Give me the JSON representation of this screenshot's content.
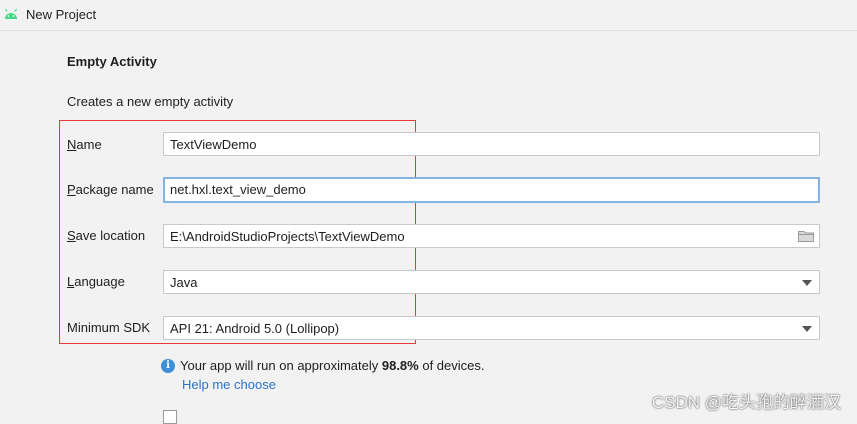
{
  "window": {
    "title": "New Project",
    "icon": "android-icon"
  },
  "section": {
    "heading": "Empty Activity",
    "description": "Creates a new empty activity"
  },
  "form": {
    "name": {
      "label_mnemonic": "N",
      "label_rest": "ame",
      "value": "TextViewDemo"
    },
    "package_name": {
      "label_mnemonic": "P",
      "label_rest": "ackage name",
      "value": "net.hxl.text_view_demo"
    },
    "save_location": {
      "label_mnemonic": "S",
      "label_rest": "ave location",
      "value": "E:\\AndroidStudioProjects\\TextViewDemo",
      "icon": "folder-icon"
    },
    "language": {
      "label_mnemonic": "L",
      "label_rest": "anguage",
      "value": "Java",
      "icon": "chevron-down-icon"
    },
    "minimum_sdk": {
      "label": "Minimum SDK",
      "value": "API 21: Android 5.0 (Lollipop)",
      "icon": "chevron-down-icon"
    }
  },
  "info": {
    "icon": "info-icon",
    "text_before": "Your app will run on approximately ",
    "percentage": "98.8%",
    "text_after": " of devices.",
    "help_link": "Help me choose"
  },
  "watermark": "CSDN @吃头孢的醉酒汉",
  "colors": {
    "background": "#f2f2f2",
    "highlight_border": "#e53a3a",
    "focus_border": "#86b3e6",
    "link": "#2e73c7",
    "info_icon": "#3d8fd6",
    "android_green": "#3ddc84"
  }
}
